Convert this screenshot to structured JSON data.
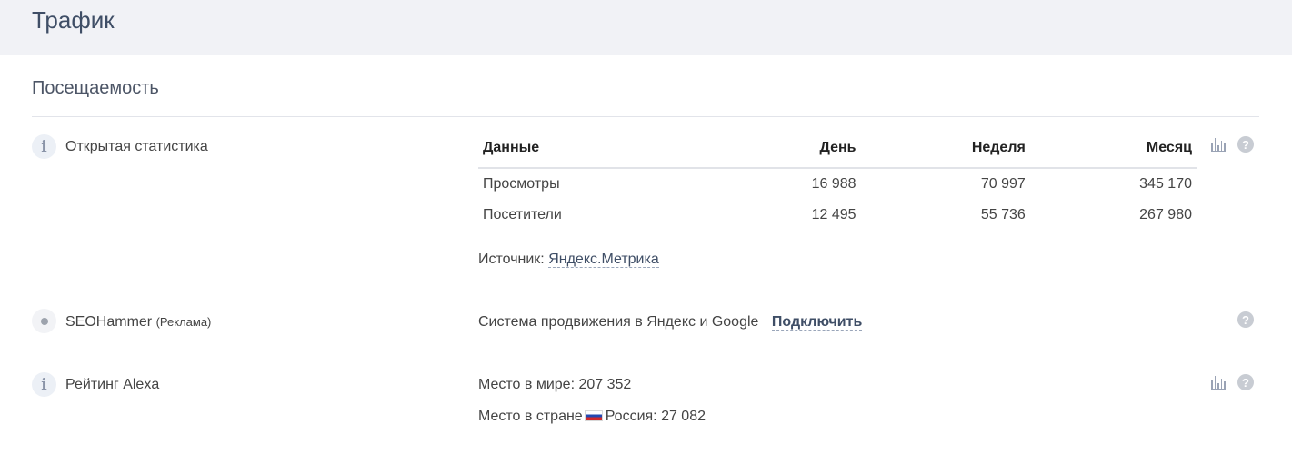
{
  "page": {
    "title": "Трафик"
  },
  "section": {
    "title": "Посещаемость"
  },
  "open_stats": {
    "label": "Открытая статистика",
    "columns": [
      "Данные",
      "День",
      "Неделя",
      "Месяц"
    ],
    "rows": [
      [
        "Просмотры",
        "16 988",
        "70 997",
        "345 170"
      ],
      [
        "Посетители",
        "12 495",
        "55 736",
        "267 980"
      ]
    ],
    "source_label": "Источник:",
    "source_link": "Яндекс.Метрика"
  },
  "seohammer": {
    "label": "SEOHammer",
    "ad_note": "(Реклама)",
    "description": "Система продвижения в Яндекс и Google",
    "connect_label": "Подключить"
  },
  "alexa": {
    "label": "Рейтинг Alexa",
    "world_text": "Место в мире: 207 352",
    "country_prefix": "Место в стране",
    "country_text": "Россия: 27 082"
  },
  "icons": {
    "info": "info-icon",
    "chart": "bar-chart-icon",
    "help": "question-mark-icon",
    "ad": "dot-icon",
    "flag": "russia-flag-icon"
  }
}
